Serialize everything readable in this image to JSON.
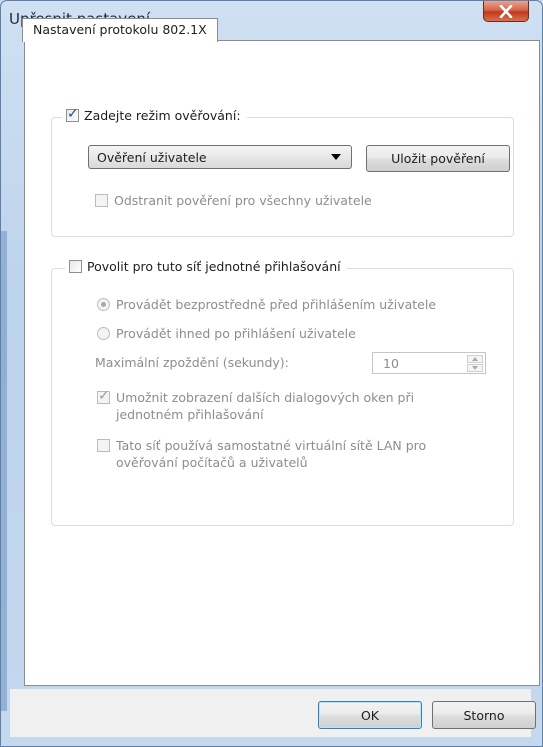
{
  "window": {
    "title": "Upřesnit nastavení"
  },
  "tabs": [
    {
      "label": "Nastavení protokolu 802.1X",
      "active": true
    }
  ],
  "auth_group": {
    "checkbox_label": "Zadejte režim ověřování:",
    "checked": true,
    "mode_select": {
      "value": "Ověření uživatele"
    },
    "save_credentials_button": "Uložit pověření",
    "remove_credentials_checkbox": {
      "label": "Odstranit pověření pro všechny uživatele",
      "checked": false,
      "disabled": true
    }
  },
  "sso_group": {
    "checkbox_label": "Povolit pro tuto síť jednotné přihlašování",
    "checked": false,
    "radio_before": {
      "label": "Provádět bezprostředně před přihlášením uživatele",
      "checked": true,
      "disabled": true
    },
    "radio_after": {
      "label": "Provádět ihned po přihlášení uživatele",
      "checked": false,
      "disabled": true
    },
    "max_delay": {
      "label": "Maximální zpoždění (sekundy):",
      "value": "10"
    },
    "allow_dialogs_checkbox": {
      "label_line1": "Umožnit zobrazení dalších dialogových oken při",
      "label_line2": "jednotném přihlašování",
      "checked": true,
      "disabled": true
    },
    "vlan_checkbox": {
      "label_line1": "Tato síť používá samostatné virtuální sítě LAN pro",
      "label_line2": "ověřování počítačů a uživatelů",
      "checked": false,
      "disabled": true
    }
  },
  "footer": {
    "ok_button": "OK",
    "cancel_button": "Storno"
  },
  "colors": {
    "title_bar": "#bcd3ec",
    "close_button": "#c1391c",
    "checkbox_check": "#2a4a9a",
    "disabled_text": "#8d8d8d"
  }
}
